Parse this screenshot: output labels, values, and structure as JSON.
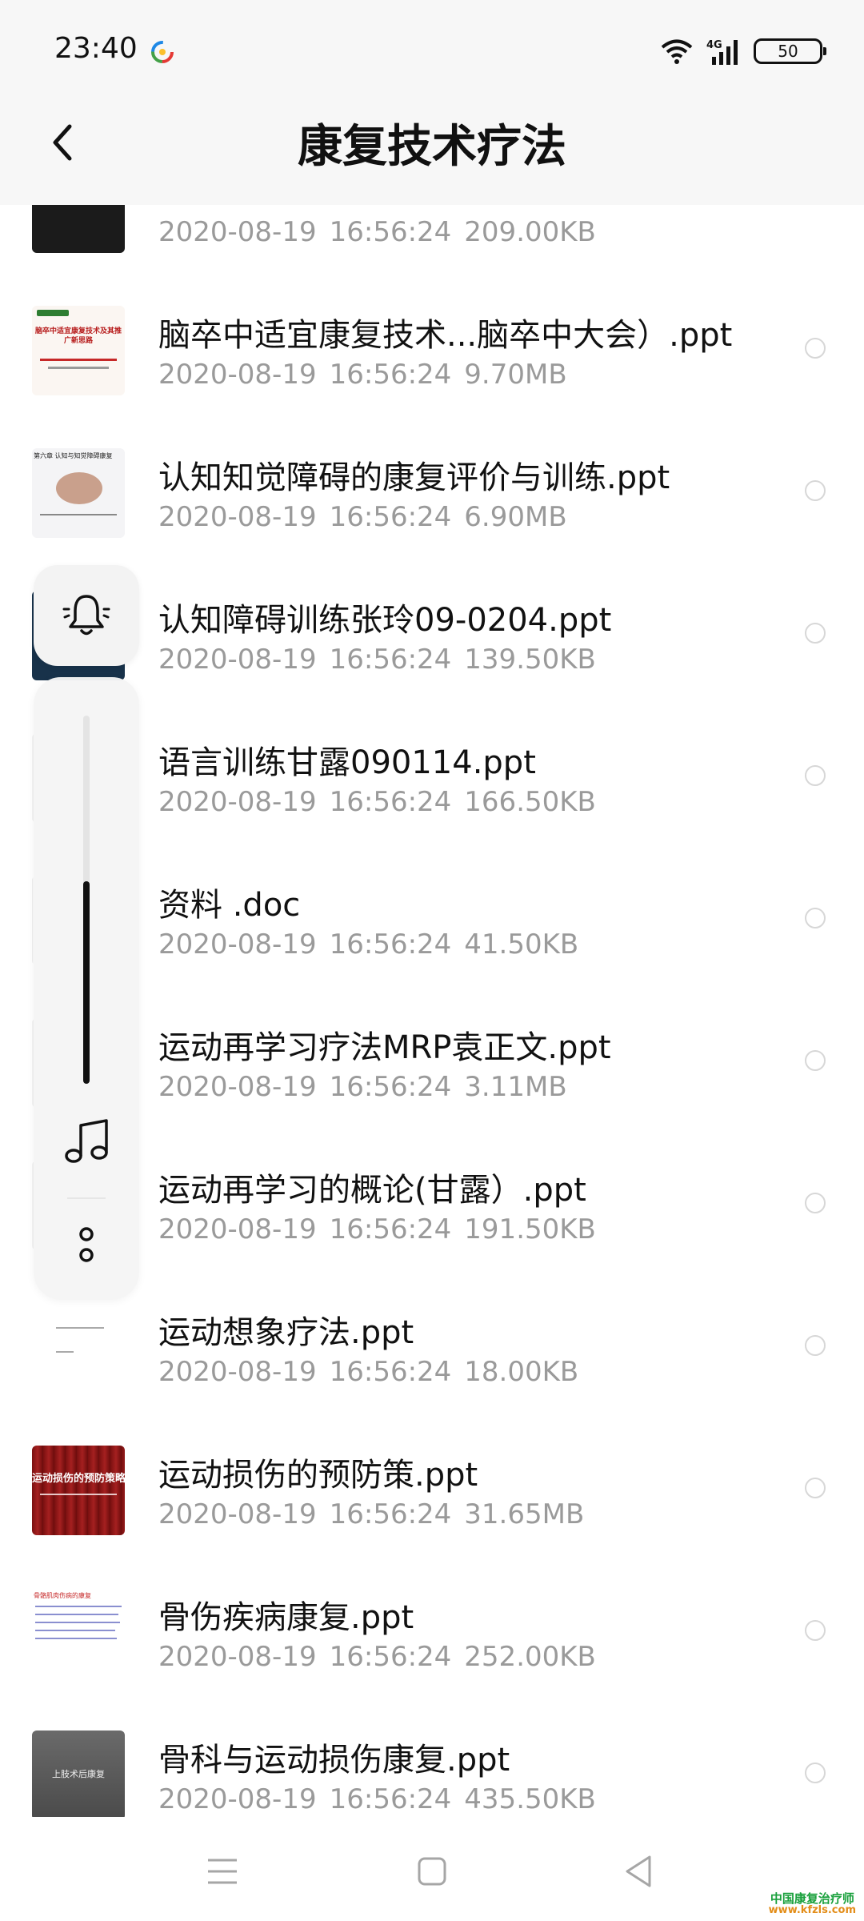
{
  "status_bar": {
    "time": "23:40",
    "network": "4G",
    "battery": "50"
  },
  "header": {
    "title": "康复技术疗法"
  },
  "files": [
    {
      "name": "",
      "date": "2020-08-19",
      "time": "16:56:24",
      "size": "209.00KB",
      "thumb": "dark"
    },
    {
      "name": "脑卒中适宜康复技术...脑卒中大会）.ppt",
      "date": "2020-08-19",
      "time": "16:56:24",
      "size": "9.70MB",
      "thumb": "slide-red-title"
    },
    {
      "name": "认知知觉障碍的康复评价与训练.ppt",
      "date": "2020-08-19",
      "time": "16:56:24",
      "size": "6.90MB",
      "thumb": "slide-brain"
    },
    {
      "name": "认知障碍训练张玲09-0204.ppt",
      "date": "2020-08-19",
      "time": "16:56:24",
      "size": "139.50KB",
      "thumb": "slide-dark-blue"
    },
    {
      "name": "语言训练甘露090114.ppt",
      "date": "2020-08-19",
      "time": "16:56:24",
      "size": "166.50KB",
      "thumb": "slide-light"
    },
    {
      "name": "资料 .doc",
      "date": "2020-08-19",
      "time": "16:56:24",
      "size": "41.50KB",
      "thumb": "doc"
    },
    {
      "name": "运动再学习疗法MRP袁正文.ppt",
      "date": "2020-08-19",
      "time": "16:56:24",
      "size": "3.11MB",
      "thumb": "slide-light"
    },
    {
      "name": "运动再学习的概论(甘露）.ppt",
      "date": "2020-08-19",
      "time": "16:56:24",
      "size": "191.50KB",
      "thumb": "slide-light"
    },
    {
      "name": "运动想象疗法.ppt",
      "date": "2020-08-19",
      "time": "16:56:24",
      "size": "18.00KB",
      "thumb": "slide-white-text"
    },
    {
      "name": "运动损伤的预防策.ppt",
      "date": "2020-08-19",
      "time": "16:56:24",
      "size": "31.65MB",
      "thumb": "slide-curtain"
    },
    {
      "name": "骨伤疾病康复.ppt",
      "date": "2020-08-19",
      "time": "16:56:24",
      "size": "252.00KB",
      "thumb": "slide-bullets"
    },
    {
      "name": "骨科与运动损伤康复.ppt",
      "date": "2020-08-19",
      "time": "16:56:24",
      "size": "435.50KB",
      "thumb": "slide-gray"
    }
  ],
  "thumb_text": {
    "red_title": "脑卒中适宜康复技术及其推广新思路",
    "brain_header": "第六章  认知与知觉障碍康复",
    "curtain": "运动损伤的预防策略",
    "bullets_header": "骨骼肌肉伤病的康复",
    "gray": "上肢术后康复"
  },
  "volume": {
    "level": 0.55
  },
  "watermark": {
    "line1": "中国康复治疗师",
    "line2": "www.kfzls.com"
  },
  "colors": {
    "accent": "#111111",
    "meta": "#9a9a9a"
  }
}
